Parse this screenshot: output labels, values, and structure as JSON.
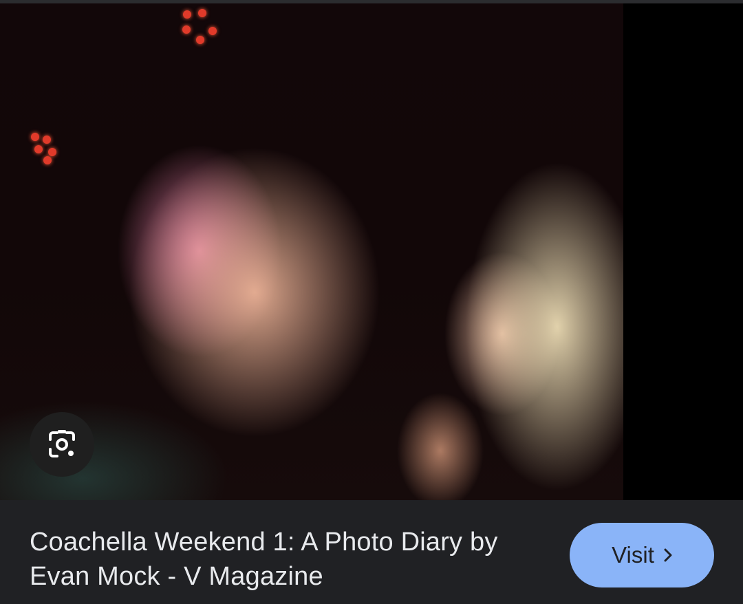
{
  "result": {
    "title": "Coachella Weekend 1: A Photo Diary by Evan Mock - V Magazine",
    "visit_label": "Visit"
  },
  "icons": {
    "lens": "google-lens-icon",
    "chevron": "chevron-right-icon"
  },
  "colors": {
    "background": "#202124",
    "visit_button": "#8ab4f8",
    "title_text": "#e8eaed"
  }
}
